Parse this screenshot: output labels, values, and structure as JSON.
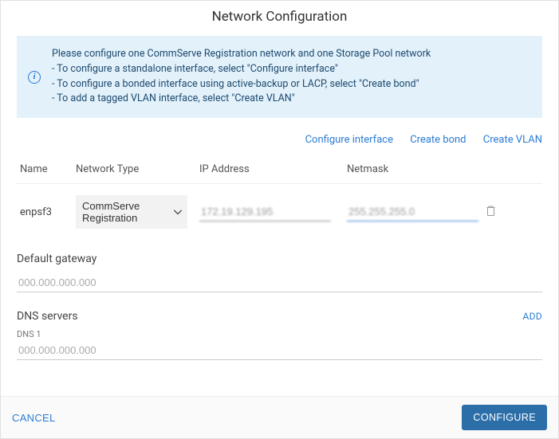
{
  "title": "Network Configuration",
  "info": {
    "line1": "Please configure one CommServe Registration network and one Storage Pool network",
    "line2": "- To configure a standalone interface, select \"Configure interface\"",
    "line3": "- To configure a bonded interface using active-backup or LACP, select \"Create bond\"",
    "line4": "- To add a tagged VLAN interface, select \"Create VLAN\""
  },
  "links": {
    "configure": "Configure interface",
    "bond": "Create bond",
    "vlan": "Create VLAN"
  },
  "headers": {
    "name": "Name",
    "type": "Network Type",
    "ip": "IP Address",
    "mask": "Netmask"
  },
  "row": {
    "name": "enpsf3",
    "type": "CommServe Registration",
    "ip": "172.19.129.195",
    "mask": "255.255.255.0"
  },
  "gateway": {
    "label": "Default gateway",
    "placeholder": "000.000.000.000"
  },
  "dns": {
    "label": "DNS servers",
    "add": "ADD",
    "sub": "DNS 1",
    "placeholder": "000.000.000.000"
  },
  "footer": {
    "cancel": "CANCEL",
    "configure": "CONFIGURE"
  }
}
